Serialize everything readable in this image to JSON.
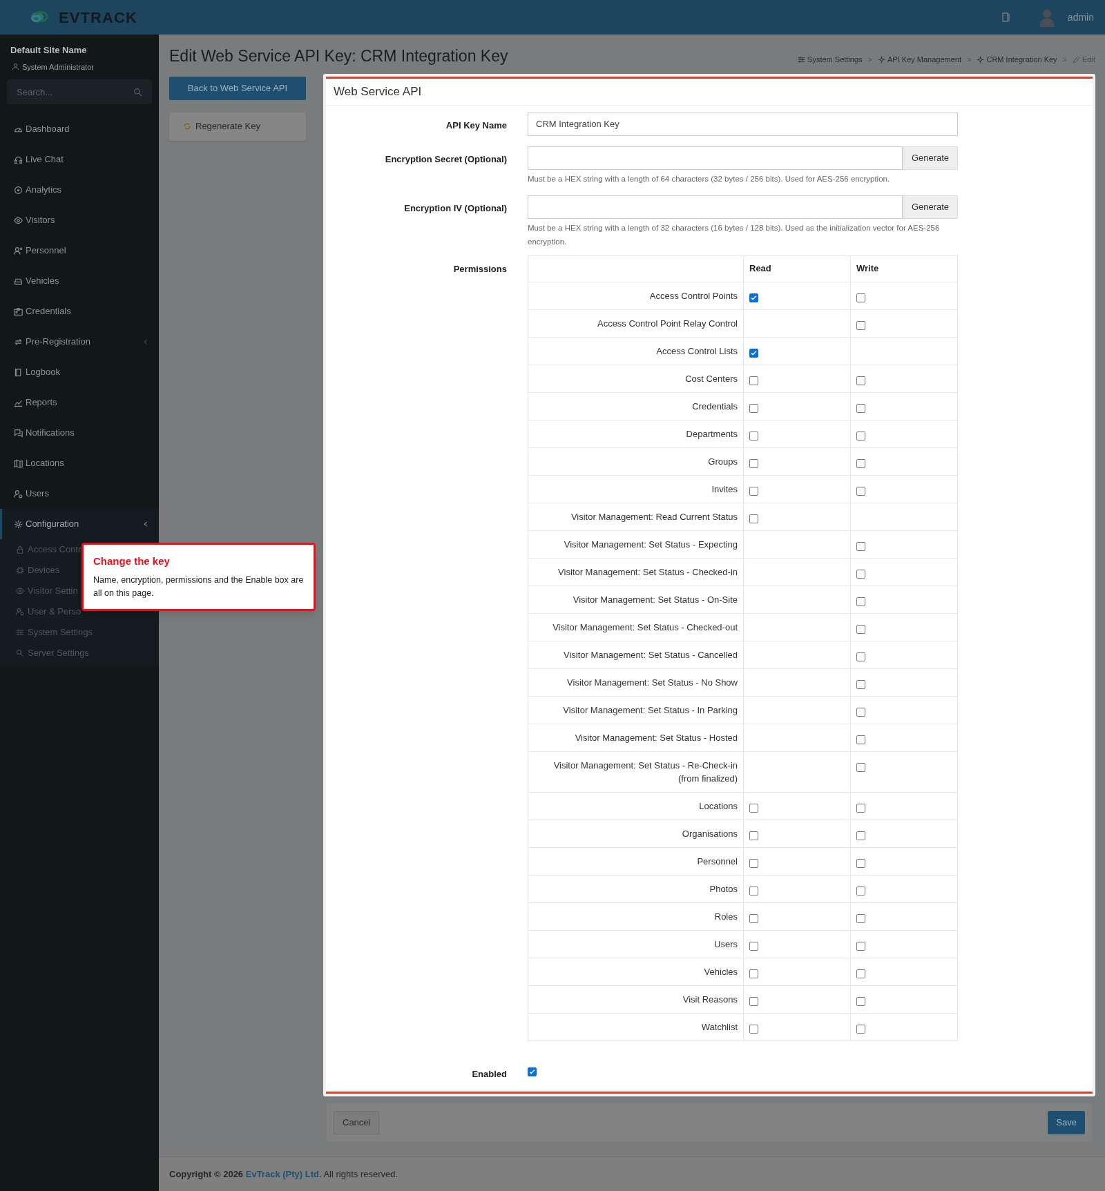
{
  "header": {
    "logo": "EVTRACK",
    "user": "admin"
  },
  "sidebar": {
    "site_name": "Default Site Name",
    "role": "System Administrator",
    "search": {
      "placeholder": "Search..."
    },
    "items": [
      {
        "label": "Dashboard",
        "selected": false
      },
      {
        "label": "Live Chat",
        "selected": false
      },
      {
        "label": "Analytics",
        "selected": false
      },
      {
        "label": "Visitors",
        "selected": false
      },
      {
        "label": "Personnel",
        "selected": false
      },
      {
        "label": "Vehicles",
        "selected": false
      },
      {
        "label": "Credentials",
        "selected": false
      },
      {
        "label": "Pre-Registration",
        "selected": false,
        "expanded": false
      },
      {
        "label": "Logbook",
        "selected": false
      },
      {
        "label": "Reports",
        "selected": false
      },
      {
        "label": "Notifications",
        "selected": false
      },
      {
        "label": "Locations",
        "selected": false
      },
      {
        "label": "Users",
        "selected": false
      },
      {
        "label": "Configuration",
        "selected": true,
        "expanded": true,
        "children": [
          {
            "label": "Access Contr"
          },
          {
            "label": "Devices"
          },
          {
            "label": "Visitor Settin"
          },
          {
            "label": "User & Perso"
          },
          {
            "label": "System Settings"
          },
          {
            "label": "Server Settings"
          }
        ]
      }
    ]
  },
  "page": {
    "title": "Edit Web Service API Key: CRM Integration Key",
    "breadcrumb": [
      "System Settings",
      "API Key Management",
      "CRM Integration Key",
      "Edit"
    ],
    "breadcrumb_separator": ">",
    "buttons": [
      "Back to Web Service API",
      "Regenerate Key"
    ]
  },
  "card": {
    "title": "Web Service API",
    "api_key_name": {
      "label": "API Key Name",
      "value": "CRM Integration Key"
    },
    "encryption_secret": {
      "label": "Encryption Secret (Optional)",
      "button": "Generate",
      "help": "Must be a HEX string with a length of 64 characters (32 bytes / 256 bits). Used for AES-256 encryption."
    },
    "encryption_iv": {
      "label": "Encryption IV (Optional)",
      "button": "Generate",
      "help": "Must be a HEX string with a length of 32 characters (16 bytes / 128 bits). Used as the initialization vector for AES-256 encryption."
    },
    "permissions_label": "Permissions",
    "permission_columns": [
      "Read",
      "Write"
    ],
    "permissions": [
      {
        "name": "Access Control Points",
        "read": true,
        "write": false
      },
      {
        "name": "Access Control Point Relay Control",
        "write": false
      },
      {
        "name": "Access Control Lists",
        "read": true
      },
      {
        "name": "Cost Centers",
        "read": false,
        "write": false
      },
      {
        "name": "Credentials",
        "read": false,
        "write": false
      },
      {
        "name": "Departments",
        "read": false,
        "write": false
      },
      {
        "name": "Groups",
        "read": false,
        "write": false
      },
      {
        "name": "Invites",
        "read": false,
        "write": false
      },
      {
        "name": "Visitor Management: Read Current Status",
        "read": false
      },
      {
        "name": "Visitor Management: Set Status - Expecting",
        "write": false
      },
      {
        "name": "Visitor Management: Set Status - Checked-in",
        "write": false
      },
      {
        "name": "Visitor Management: Set Status - On-Site",
        "write": false
      },
      {
        "name": "Visitor Management: Set Status - Checked-out",
        "write": false
      },
      {
        "name": "Visitor Management: Set Status - Cancelled",
        "write": false
      },
      {
        "name": "Visitor Management: Set Status - No Show",
        "write": false
      },
      {
        "name": "Visitor Management: Set Status - In Parking",
        "write": false
      },
      {
        "name": "Visitor Management: Set Status - Hosted",
        "write": false
      },
      {
        "name": "Visitor Management: Set Status - Re-Check-in (from finalized)",
        "write": false
      },
      {
        "name": "Locations",
        "read": false,
        "write": false
      },
      {
        "name": "Organisations",
        "read": false,
        "write": false
      },
      {
        "name": "Personnel",
        "read": false,
        "write": false
      },
      {
        "name": "Photos",
        "read": false,
        "write": false
      },
      {
        "name": "Roles",
        "read": false,
        "write": false
      },
      {
        "name": "Users",
        "read": false,
        "write": false
      },
      {
        "name": "Vehicles",
        "read": false,
        "write": false
      },
      {
        "name": "Visit Reasons",
        "read": false,
        "write": false
      },
      {
        "name": "Watchlist",
        "read": false,
        "write": false
      }
    ],
    "enabled": {
      "label": "Enabled",
      "checked": true
    }
  },
  "actions": {
    "cancel": "Cancel",
    "save": "Save"
  },
  "footer": {
    "copyright": "**Copyright © 2026** ",
    "company": "EvTrack (Pty) Ltd.",
    "rest": " All rights reserved."
  },
  "tour_tooltip": {
    "title": "Change the key",
    "text": "Name, encryption, permissions and the Enable box are all on this page."
  }
}
